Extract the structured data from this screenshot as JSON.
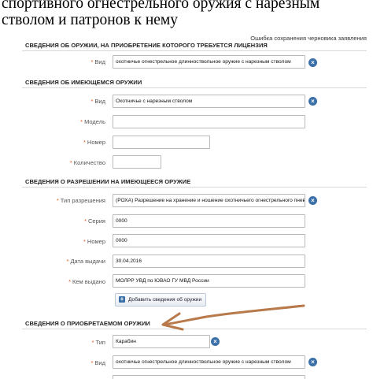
{
  "page": {
    "title": "спортивного огнестрельного оружия с нарезным стволом и патронов к нему",
    "save_error": "Ошибка сохранения черновика заявления"
  },
  "sections": {
    "requested_weapon": {
      "header": "Сведения об оружии, на приобретение которого требуется лицензия"
    },
    "existing_weapon": {
      "header": "Сведения об имеющемся оружии"
    },
    "permit": {
      "header": "Сведения о разрешении на имеющееся оружие"
    },
    "acquired_weapon": {
      "header": "Сведения о приобретаемом оружии"
    }
  },
  "fields": {
    "req_vid": {
      "label": "Вид",
      "value": "охотничье огнестрельное длинноствольное оружие с нарезным стволом"
    },
    "exist_vid": {
      "label": "Вид",
      "value": "Охотничье с нарезным стволом"
    },
    "model": {
      "label": "Модель",
      "value": ""
    },
    "number": {
      "label": "Номер",
      "value": ""
    },
    "count": {
      "label": "Количество",
      "value": ""
    },
    "permit_type": {
      "label": "Тип разрешения",
      "value": "(РОХА) Разрешение на хранение и ношение охотничьего огнестрельного пневм"
    },
    "series": {
      "label": "Серия",
      "value": "0000"
    },
    "permit_number": {
      "label": "Номер",
      "value": "0000"
    },
    "issue_date": {
      "label": "Дата выдачи",
      "value": "30.04.2016"
    },
    "issued_by": {
      "label": "Кем выдано",
      "value": "МОЛРР УВД по ЮВАО ГУ МВД России"
    },
    "acq_type": {
      "label": "Тип",
      "value": "Карабин"
    },
    "acq_vid": {
      "label": "Вид",
      "value": "охотничье огнестрельное длинноствольное оружие с нарезным стволом"
    }
  },
  "buttons": {
    "add_weapon": "Добавить сведения об оружии",
    "clear_glyph": "×",
    "plus_glyph": "+"
  },
  "required_marker": "*",
  "annotation": {
    "arrow_color": "#b87a4a"
  }
}
